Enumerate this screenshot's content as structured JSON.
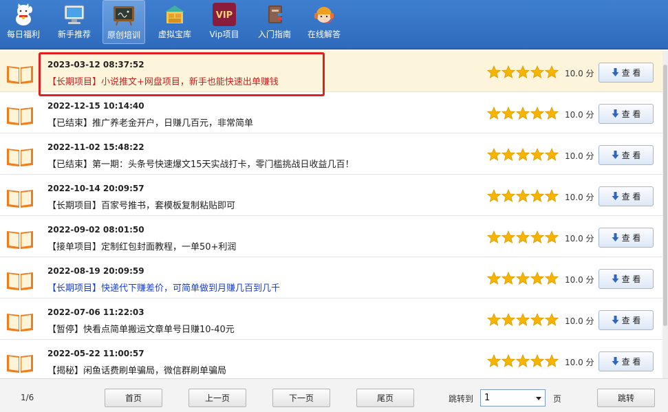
{
  "toolbar": {
    "items": [
      {
        "label": "每日福利",
        "icon": "lucky-cat-icon"
      },
      {
        "label": "新手推荐",
        "icon": "monitor-icon"
      },
      {
        "label": "原创培训",
        "icon": "blackboard-icon",
        "active": true
      },
      {
        "label": "虚拟宝库",
        "icon": "warehouse-icon"
      },
      {
        "label": "Vip项目",
        "icon": "vip-badge-icon"
      },
      {
        "label": "入门指南",
        "icon": "guide-book-icon"
      },
      {
        "label": "在线解答",
        "icon": "headset-support-icon"
      }
    ]
  },
  "list": {
    "score_text": "10.0 分",
    "view_label": "查 看",
    "items": [
      {
        "date": "2023-03-12 08:37:52",
        "title": "【长期项目】小说推文+网盘项目，新手也能快速出单赚钱",
        "color": "#c8201e",
        "selected": true
      },
      {
        "date": "2022-12-15 10:14:40",
        "title": "【已结束】推广养老金开户，日赚几百元，非常简单",
        "color": "#222222"
      },
      {
        "date": "2022-11-02 15:48:22",
        "title": "【已结束】第一期：头条号快速爆文15天实战打卡，零门槛挑战日收益几百！",
        "color": "#222222"
      },
      {
        "date": "2022-10-14 20:09:57",
        "title": "【长期项目】百家号推书，套模板复制粘贴即可",
        "color": "#222222"
      },
      {
        "date": "2022-09-02 08:01:50",
        "title": "【接单项目】定制红包封面教程，一单50+利润",
        "color": "#222222"
      },
      {
        "date": "2022-08-19 20:09:59",
        "title": "【长期项目】快递代下赚差价，可简单做到月赚几百到几千",
        "color": "#1a3fd0"
      },
      {
        "date": "2022-07-06 11:22:03",
        "title": "【暂停】快看点简单搬运文章单号日赚10-40元",
        "color": "#222222"
      },
      {
        "date": "2022-05-22 11:00:57",
        "title": "【揭秘】闲鱼话费刷单骗局，微信群刷单骗局",
        "color": "#222222"
      }
    ],
    "rating_stars": 5,
    "star_color": "#f7b500"
  },
  "footer": {
    "page_info": "1/6",
    "first": "首页",
    "prev": "上一页",
    "next": "下一页",
    "last": "尾页",
    "jump_label": "跳转到",
    "page_value": "1",
    "page_unit": "页",
    "jump_button": "跳转"
  }
}
